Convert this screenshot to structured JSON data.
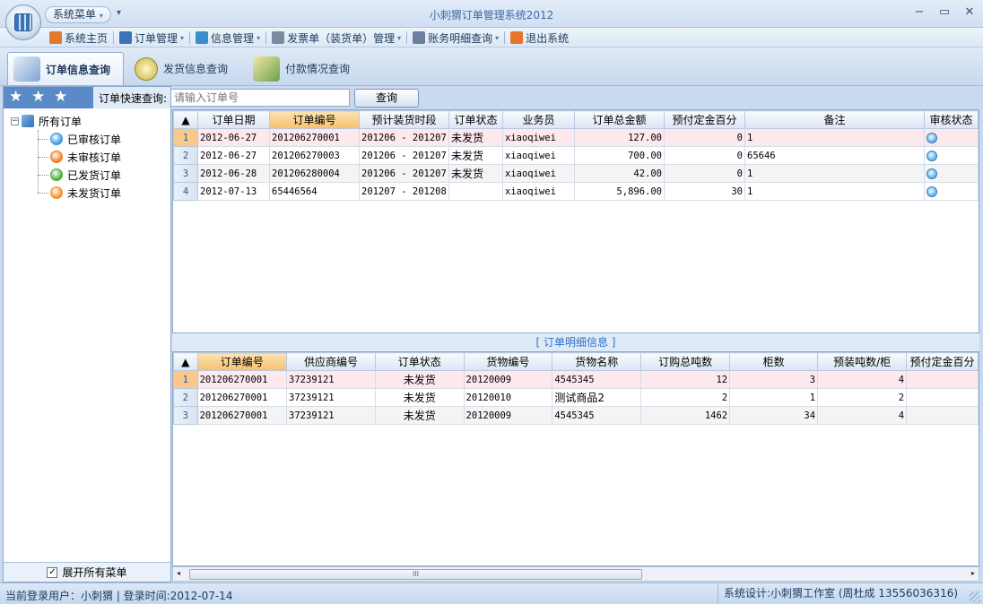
{
  "window": {
    "title": "小刺猬订单管理系统2012",
    "system_menu": "系统菜单",
    "minimize": "−",
    "maximize": "▭",
    "close": "✕"
  },
  "menubar": [
    {
      "label": "系统主页",
      "icon": "home-icon",
      "dropdown": false,
      "color": "#e07a2e"
    },
    {
      "label": "订单管理",
      "icon": "order-icon",
      "dropdown": true,
      "color": "#3b73b9"
    },
    {
      "label": "信息管理",
      "icon": "gear-icon",
      "dropdown": true,
      "color": "#3b8ec9"
    },
    {
      "label": "发票单（装货单）管理",
      "icon": "document-icon",
      "dropdown": true,
      "color": "#7a8aa0"
    },
    {
      "label": "账务明细查询",
      "icon": "calendar-icon",
      "dropdown": true,
      "color": "#6c7fa0"
    },
    {
      "label": "退出系统",
      "icon": "exit-icon",
      "dropdown": false,
      "color": "#e8742a"
    }
  ],
  "tabs": [
    {
      "label": "订单信息查询",
      "icon": "order-search-icon",
      "active": true
    },
    {
      "label": "发货信息查询",
      "icon": "clock-icon",
      "active": false
    },
    {
      "label": "付款情况查询",
      "icon": "money-icon",
      "active": false
    }
  ],
  "search": {
    "label": "订单快速查询:",
    "placeholder": "请输入订单号",
    "button": "查询"
  },
  "tree": {
    "root": "所有订单",
    "expander": "−",
    "children": [
      {
        "label": "已审核订单",
        "icon": "approved-icon",
        "color": "#3a9be0"
      },
      {
        "label": "未审核订单",
        "icon": "pending-icon",
        "color": "#f07d2a"
      },
      {
        "label": "已发货订单",
        "icon": "shipped-icon",
        "color": "#4cae3c"
      },
      {
        "label": "未发货订单",
        "icon": "unshipped-icon",
        "color": "#f0902a"
      }
    ],
    "expand_all_label": "展开所有菜单",
    "expand_all_checked": true
  },
  "orders": {
    "corner": "▲",
    "headers": [
      "订单日期",
      "订单编号",
      "预计装货时段",
      "订单状态",
      "业务员",
      "订单总金额",
      "预付定金百分",
      "备注",
      "审核状态"
    ],
    "rows": [
      {
        "no": "1",
        "date": "2012-06-27",
        "id": "201206270001",
        "period": "201206 - 201207",
        "status": "未发货",
        "sales": "xiaoqiwei",
        "amount": "127.00",
        "deposit": "0",
        "note": "1",
        "audited": true
      },
      {
        "no": "2",
        "date": "2012-06-27",
        "id": "201206270003",
        "period": "201206 - 201207",
        "status": "未发货",
        "sales": "xiaoqiwei",
        "amount": "700.00",
        "deposit": "0",
        "note": "65646",
        "audited": true
      },
      {
        "no": "3",
        "date": "2012-06-28",
        "id": "201206280004",
        "period": "201206 - 201207",
        "status": "未发货",
        "sales": "xiaoqiwei",
        "amount": "42.00",
        "deposit": "0",
        "note": "1",
        "audited": true
      },
      {
        "no": "4",
        "date": "2012-07-13",
        "id": "65446564",
        "period": "201207 - 201208",
        "status": "",
        "sales": "xiaoqiwei",
        "amount": "5,896.00",
        "deposit": "30",
        "note": "1",
        "audited": true
      }
    ]
  },
  "details": {
    "title": "[ 订单明细信息 ]",
    "corner": "▲",
    "headers": [
      "订单编号",
      "供应商编号",
      "订单状态",
      "货物编号",
      "货物名称",
      "订购总吨数",
      "柜数",
      "预装吨数/柜",
      "预付定金百分"
    ],
    "rows": [
      {
        "no": "1",
        "order_id": "201206270001",
        "supplier": "37239121",
        "status": "未发货",
        "goods_no": "20120009",
        "goods_name": "4545345",
        "tons": "12",
        "containers": "3",
        "per_container": "4"
      },
      {
        "no": "2",
        "order_id": "201206270001",
        "supplier": "37239121",
        "status": "未发货",
        "goods_no": "20120010",
        "goods_name": "测试商品2",
        "tons": "2",
        "containers": "1",
        "per_container": "2"
      },
      {
        "no": "3",
        "order_id": "201206270001",
        "supplier": "37239121",
        "status": "未发货",
        "goods_no": "20120009",
        "goods_name": "4545345",
        "tons": "1462",
        "containers": "34",
        "per_container": "4"
      }
    ]
  },
  "scrollbar": {
    "thumb": "III",
    "left": "◂",
    "right": "▸"
  },
  "status": {
    "left": "当前登录用户：小刺猬  |  登录时间:2012-07-14",
    "right": "系统设计:小刺猬工作室 (周杜成 13556036316)"
  }
}
